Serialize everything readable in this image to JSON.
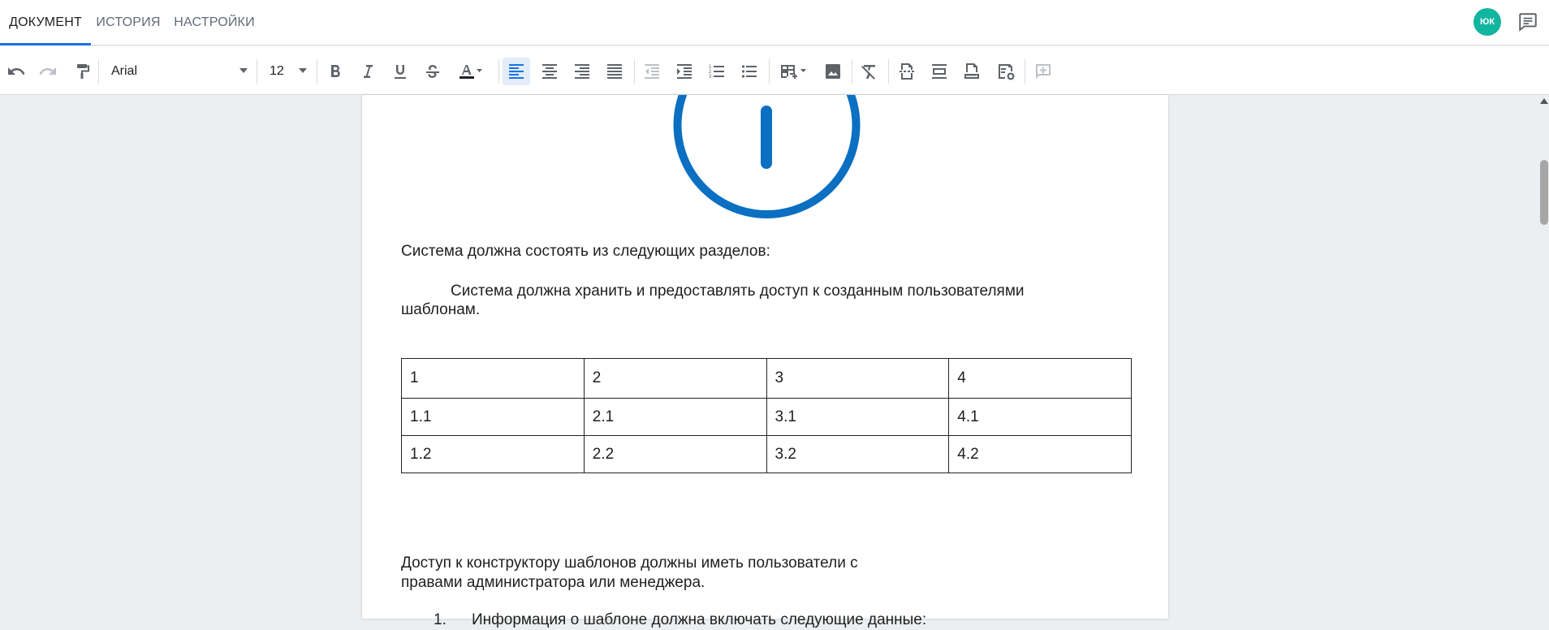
{
  "tabs": [
    {
      "label": "ДОКУМЕНТ",
      "active": true
    },
    {
      "label": "ИСТОРИЯ",
      "active": false
    },
    {
      "label": "НАСТРОЙКИ",
      "active": false
    }
  ],
  "user": {
    "initials": "ЮК",
    "avatar_color": "#12b5a0"
  },
  "toolbar": {
    "font_family": "Arial",
    "font_size": "12",
    "icons": [
      "undo-icon",
      "redo-icon",
      "paint-format-icon",
      "bold-icon",
      "italic-icon",
      "underline-icon",
      "strikethrough-icon",
      "text-color-icon",
      "align-left-icon",
      "align-center-icon",
      "align-right-icon",
      "align-justify-icon",
      "decrease-indent-icon",
      "increase-indent-icon",
      "numbered-list-icon",
      "bulleted-list-icon",
      "insert-table-icon",
      "insert-image-icon",
      "clear-formatting-icon",
      "page-break-icon",
      "header-footer-icon",
      "page-size-icon",
      "document-settings-icon",
      "add-comment-icon"
    ],
    "accent_color": "#1a73e8"
  },
  "document": {
    "image_color": "#0b6fc2",
    "para1": "Система должна состоять из следующих разделов:",
    "para2_line1": "Система должна хранить и предоставлять доступ к созданным пользователями",
    "para2_line2": "шаблонам.",
    "table": [
      [
        "1",
        "2",
        "3",
        "4"
      ],
      [
        "1.1",
        "2.1",
        "3.1",
        "4.1"
      ],
      [
        "1.2",
        "2.2",
        "3.2",
        "4.2"
      ]
    ],
    "para3_line1": "Доступ к конструктору шаблонов должны иметь пользователи с",
    "para3_line2": "правами администратора или менеджера.",
    "list_item_number": "1.",
    "list_item_text": "Информация о шаблоне должна включать следующие данные:"
  }
}
